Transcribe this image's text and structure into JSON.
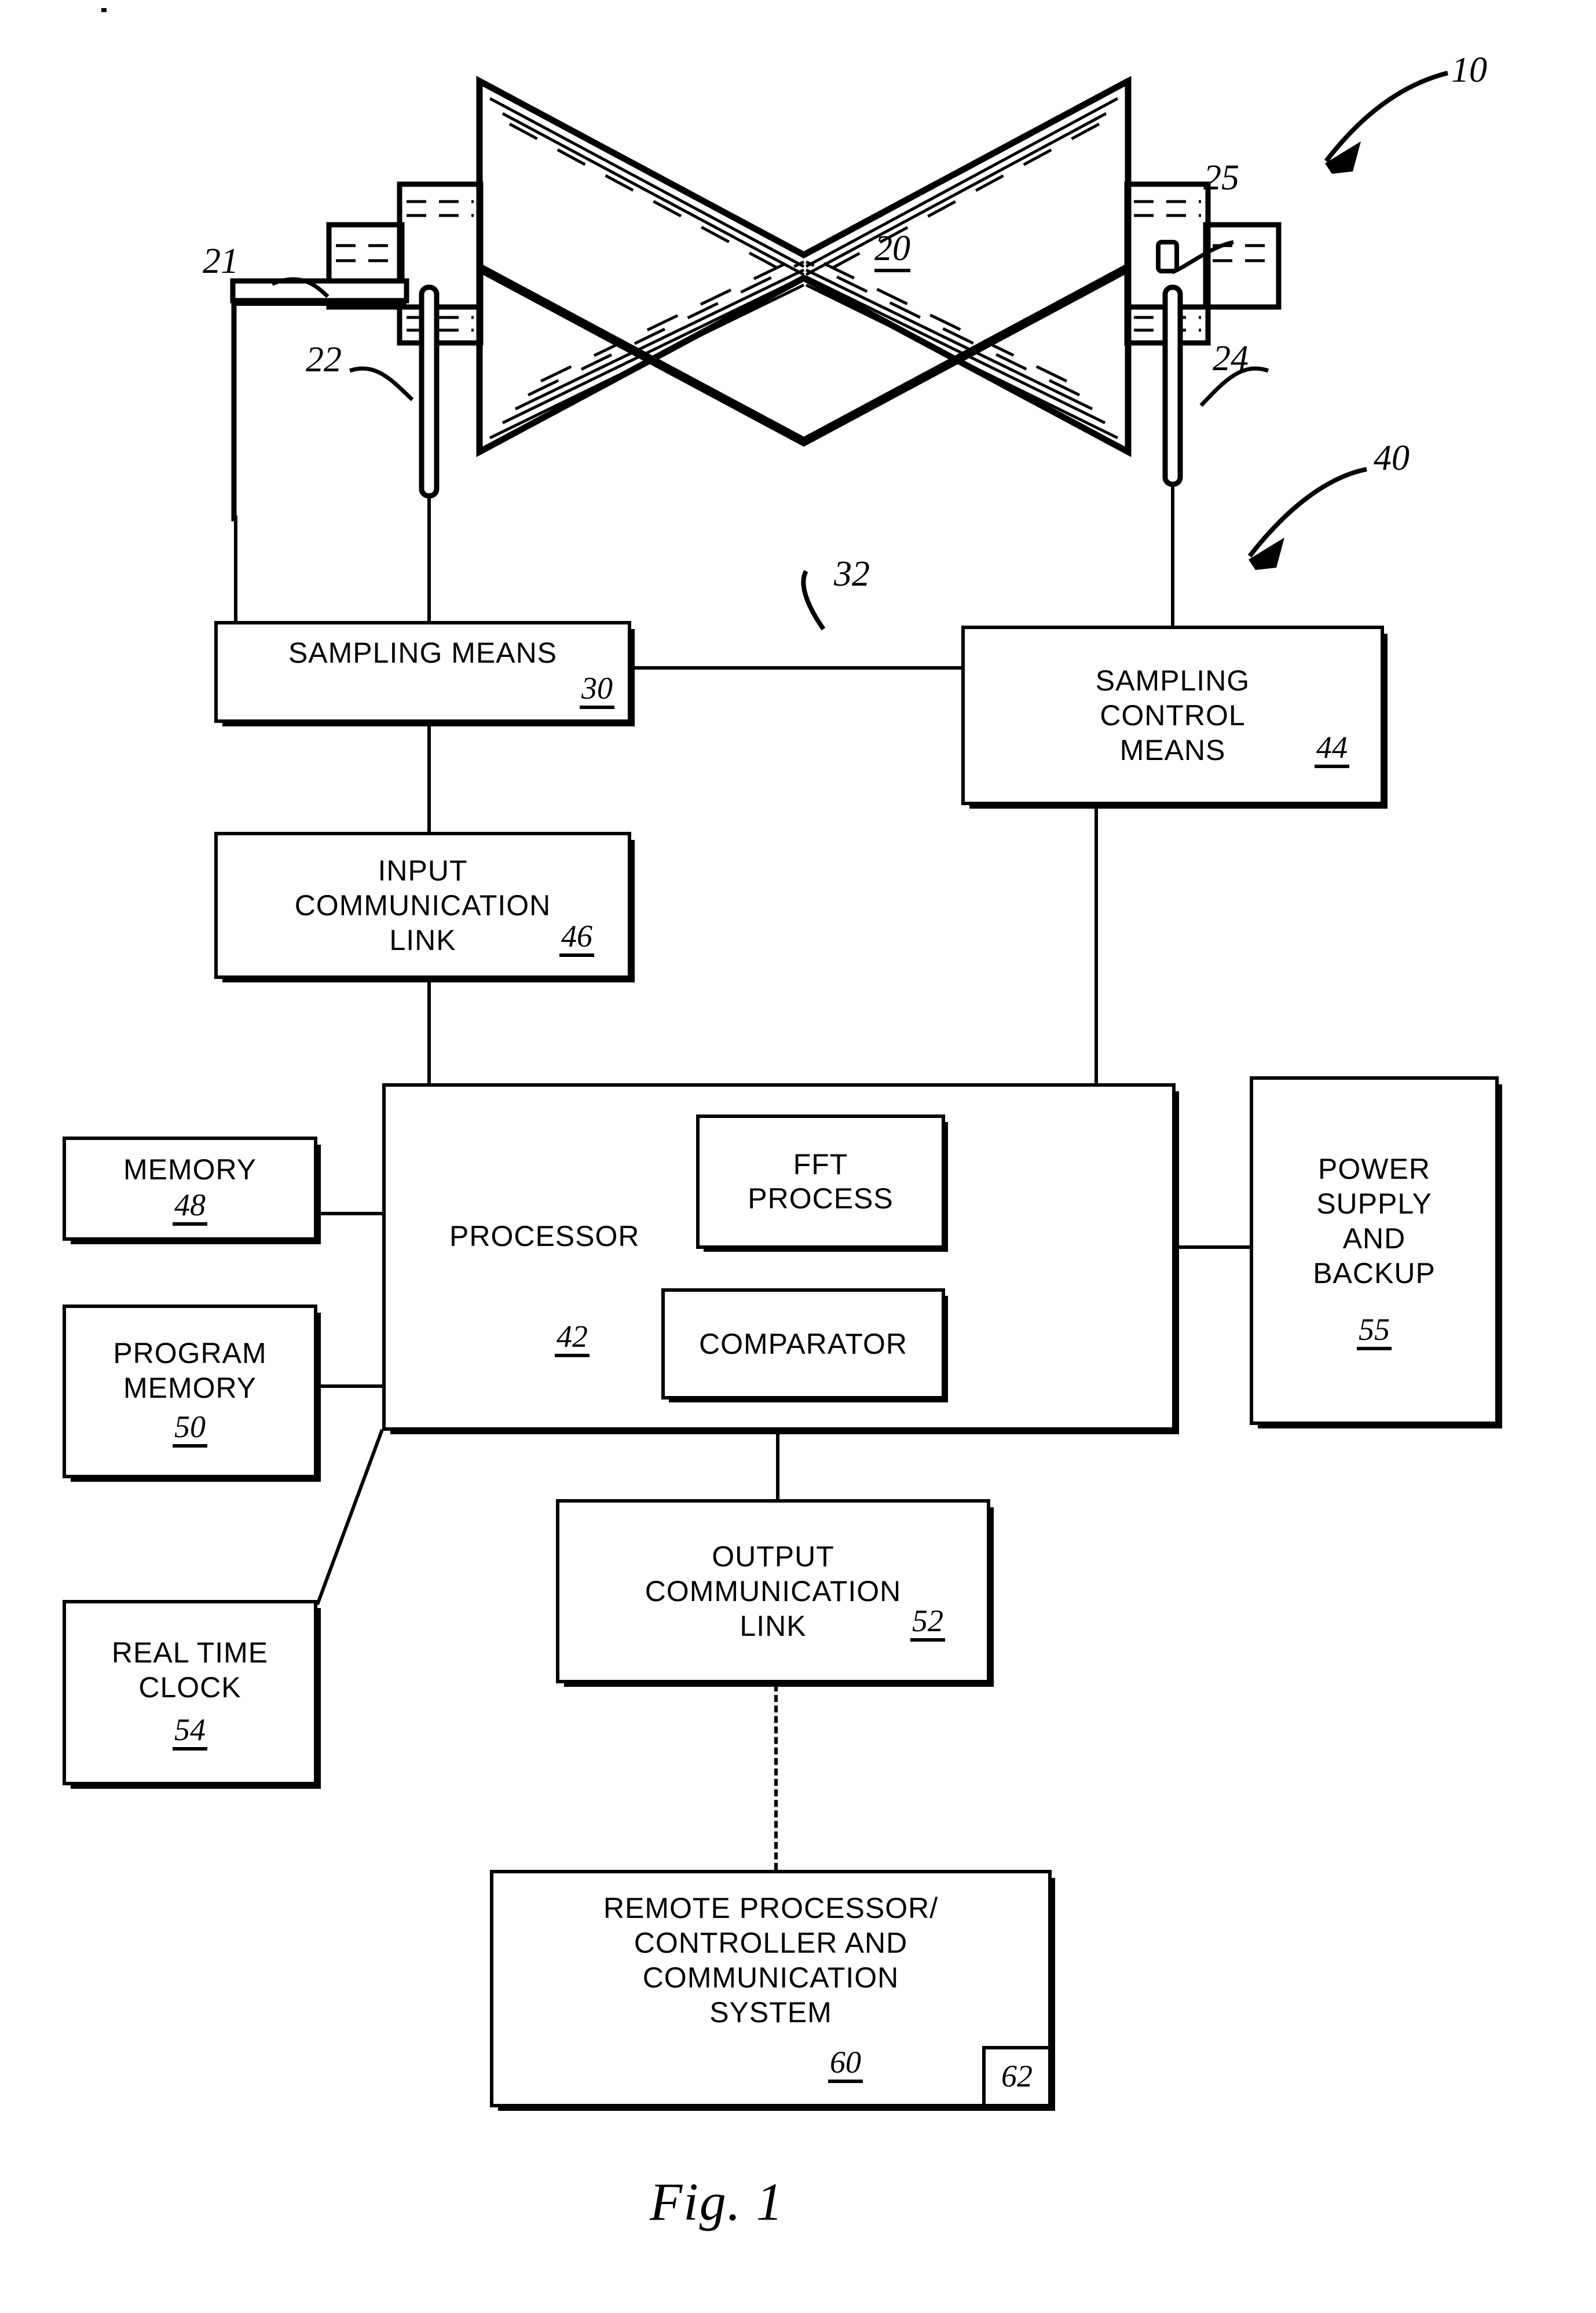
{
  "figure": {
    "caption": "Fig.  1",
    "system_ref": "10",
    "machine_ref": "20",
    "sensor_left_ref": "21",
    "lead_left_ref": "22",
    "lead_right_ref": "24",
    "sensor_right_ref": "25",
    "analyzer_ref": "40",
    "link_ref": "32"
  },
  "blocks": {
    "sampling_means": {
      "label": "SAMPLING  MEANS",
      "ref": "30"
    },
    "sampling_control": {
      "label": "SAMPLING\nCONTROL\nMEANS",
      "ref": "44"
    },
    "input_link": {
      "label": "INPUT\nCOMMUNICATION\nLINK",
      "ref": "46"
    },
    "processor": {
      "label": "PROCESSOR",
      "ref": "42"
    },
    "fft_process": {
      "label": "FFT\nPROCESS"
    },
    "comparator": {
      "label": "COMPARATOR"
    },
    "power_supply": {
      "label": "POWER\nSUPPLY\nAND\nBACKUP",
      "ref": "55"
    },
    "memory": {
      "label": "MEMORY",
      "ref": "48"
    },
    "program_memory": {
      "label": "PROGRAM\nMEMORY",
      "ref": "50"
    },
    "real_time_clock": {
      "label": "REAL TIME\nCLOCK",
      "ref": "54"
    },
    "output_link": {
      "label": "OUTPUT\nCOMMUNICATION\nLINK",
      "ref": "52"
    },
    "remote_system": {
      "label": "REMOTE PROCESSOR/\nCONTROLLER AND\nCOMMUNICATION\nSYSTEM",
      "ref": "60",
      "sub_ref": "62"
    }
  },
  "colors": {
    "ink": "#000000",
    "paper": "#ffffff"
  }
}
